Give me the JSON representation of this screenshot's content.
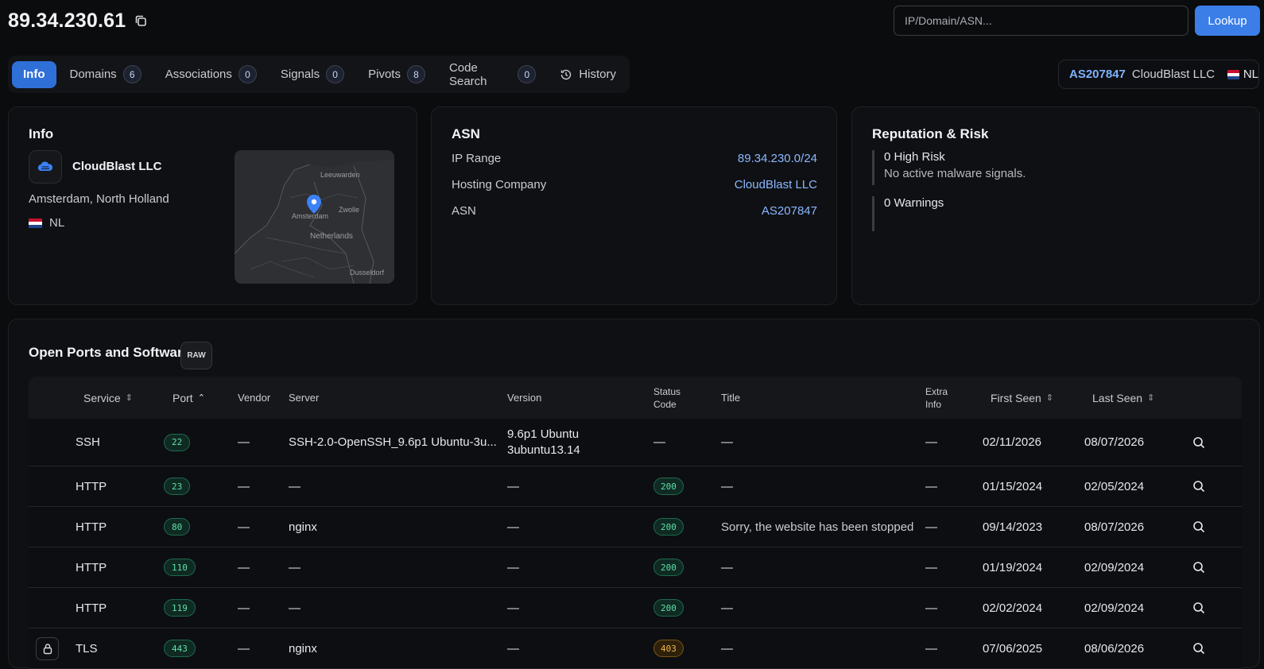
{
  "header": {
    "ip": "89.34.230.61",
    "search_placeholder": "IP/Domain/ASN...",
    "lookup_label": "Lookup"
  },
  "tabs": [
    {
      "label": "Info",
      "count": null,
      "active": true
    },
    {
      "label": "Domains",
      "count": "6"
    },
    {
      "label": "Associations",
      "count": "0"
    },
    {
      "label": "Signals",
      "count": "0"
    },
    {
      "label": "Pivots",
      "count": "8"
    },
    {
      "label": "Code Search",
      "count": "0"
    },
    {
      "label": "History",
      "count": null,
      "icon": "history-icon"
    }
  ],
  "asn_chip": {
    "asn": "AS207847",
    "org": "CloudBlast LLC",
    "country": "NL"
  },
  "info": {
    "title": "Info",
    "org": "CloudBlast LLC",
    "location": "Amsterdam, North Holland",
    "country": "NL",
    "map_labels": {
      "leeuwarden": "Leeuwarden",
      "zwolle": "Zwolle",
      "amsterdam": "Amsterdam",
      "netherlands": "Netherlands",
      "dusseldorf": "Dusseldorf"
    }
  },
  "asn": {
    "title": "ASN",
    "rows": [
      {
        "label": "IP Range",
        "value": "89.34.230.0/24"
      },
      {
        "label": "Hosting Company",
        "value": "CloudBlast LLC"
      },
      {
        "label": "ASN",
        "value": "AS207847"
      }
    ]
  },
  "reputation": {
    "title": "Reputation & Risk",
    "high_risk": "0 High Risk",
    "high_risk_sub": "No active malware signals.",
    "warnings": "0 Warnings"
  },
  "ports": {
    "title": "Open Ports and Software",
    "raw_label": "RAW",
    "headers": {
      "service": "Service",
      "port": "Port",
      "vendor": "Vendor",
      "server": "Server",
      "version": "Version",
      "status_1": "Status",
      "status_2": "Code",
      "title": "Title",
      "extra_1": "Extra",
      "extra_2": "Info",
      "first_seen": "First Seen",
      "last_seen": "Last Seen"
    },
    "rows": [
      {
        "service": "SSH",
        "port": "22",
        "vendor": "—",
        "server": "SSH-2.0-OpenSSH_9.6p1 Ubuntu-3u...",
        "version_1": "9.6p1 Ubuntu",
        "version_2": "3ubuntu13.14",
        "status": "—",
        "title": "—",
        "extra": "—",
        "first_seen": "02/11/2026",
        "last_seen": "08/07/2026"
      },
      {
        "service": "HTTP",
        "port": "23",
        "vendor": "—",
        "server": "—",
        "version_1": "—",
        "status": "200",
        "title": "—",
        "extra": "—",
        "first_seen": "01/15/2024",
        "last_seen": "02/05/2024"
      },
      {
        "service": "HTTP",
        "port": "80",
        "vendor": "—",
        "server": "nginx",
        "version_1": "—",
        "status": "200",
        "title": "Sorry, the website has been stopped",
        "extra": "—",
        "first_seen": "09/14/2023",
        "last_seen": "08/07/2026"
      },
      {
        "service": "HTTP",
        "port": "110",
        "vendor": "—",
        "server": "—",
        "version_1": "—",
        "status": "200",
        "title": "—",
        "extra": "—",
        "first_seen": "01/19/2024",
        "last_seen": "02/09/2024"
      },
      {
        "service": "HTTP",
        "port": "119",
        "vendor": "—",
        "server": "—",
        "version_1": "—",
        "status": "200",
        "title": "—",
        "extra": "—",
        "first_seen": "02/02/2024",
        "last_seen": "02/09/2024"
      },
      {
        "service": "TLS",
        "port": "443",
        "vendor": "—",
        "server": "nginx",
        "version_1": "—",
        "status": "403",
        "title": "—",
        "extra": "—",
        "first_seen": "07/06/2025",
        "last_seen": "08/06/2026"
      }
    ]
  },
  "colors": {
    "accent": "#3b7ee8",
    "link": "#8ab8ff",
    "success": "#5fe0a8",
    "warning": "#f3b44a",
    "background": "#0b0c0e"
  }
}
